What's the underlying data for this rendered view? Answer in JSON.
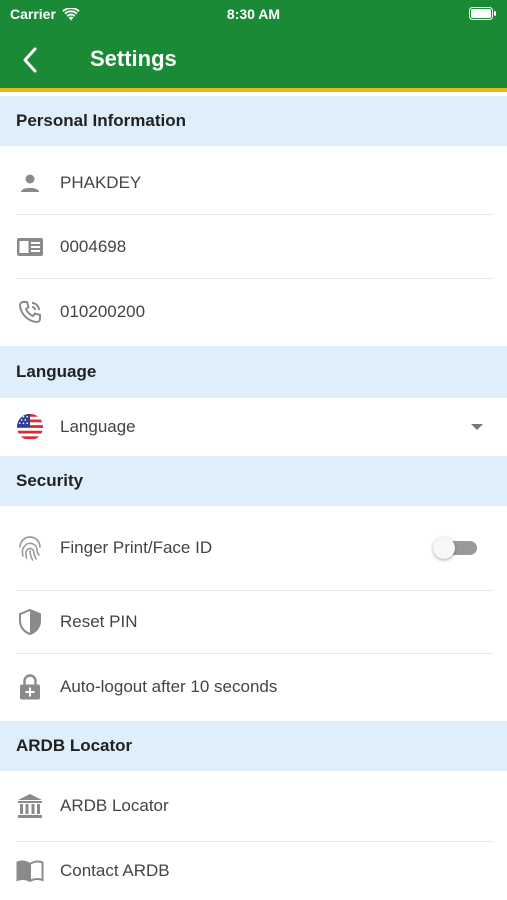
{
  "status_bar": {
    "carrier": "Carrier",
    "time": "8:30 AM"
  },
  "header": {
    "title": "Settings"
  },
  "personal_information": {
    "title": "Personal Information",
    "name": "PHAKDEY",
    "id": "0004698",
    "phone": "010200200"
  },
  "language": {
    "title": "Language",
    "label": "Language"
  },
  "security": {
    "title": "Security",
    "fingerprint_label": "Finger Print/Face ID",
    "fingerprint_enabled": false,
    "reset_pin_label": "Reset PIN",
    "auto_logout_label": "Auto-logout after 10 seconds"
  },
  "ardb_locator": {
    "title": "ARDB Locator",
    "locator_label": "ARDB Locator",
    "contact_label": "Contact ARDB"
  },
  "colors": {
    "brand_green": "#1a8a37",
    "accent_yellow": "#e8b81a",
    "section_bg": "#deeefb",
    "icon_gray": "#8a8a8a"
  }
}
